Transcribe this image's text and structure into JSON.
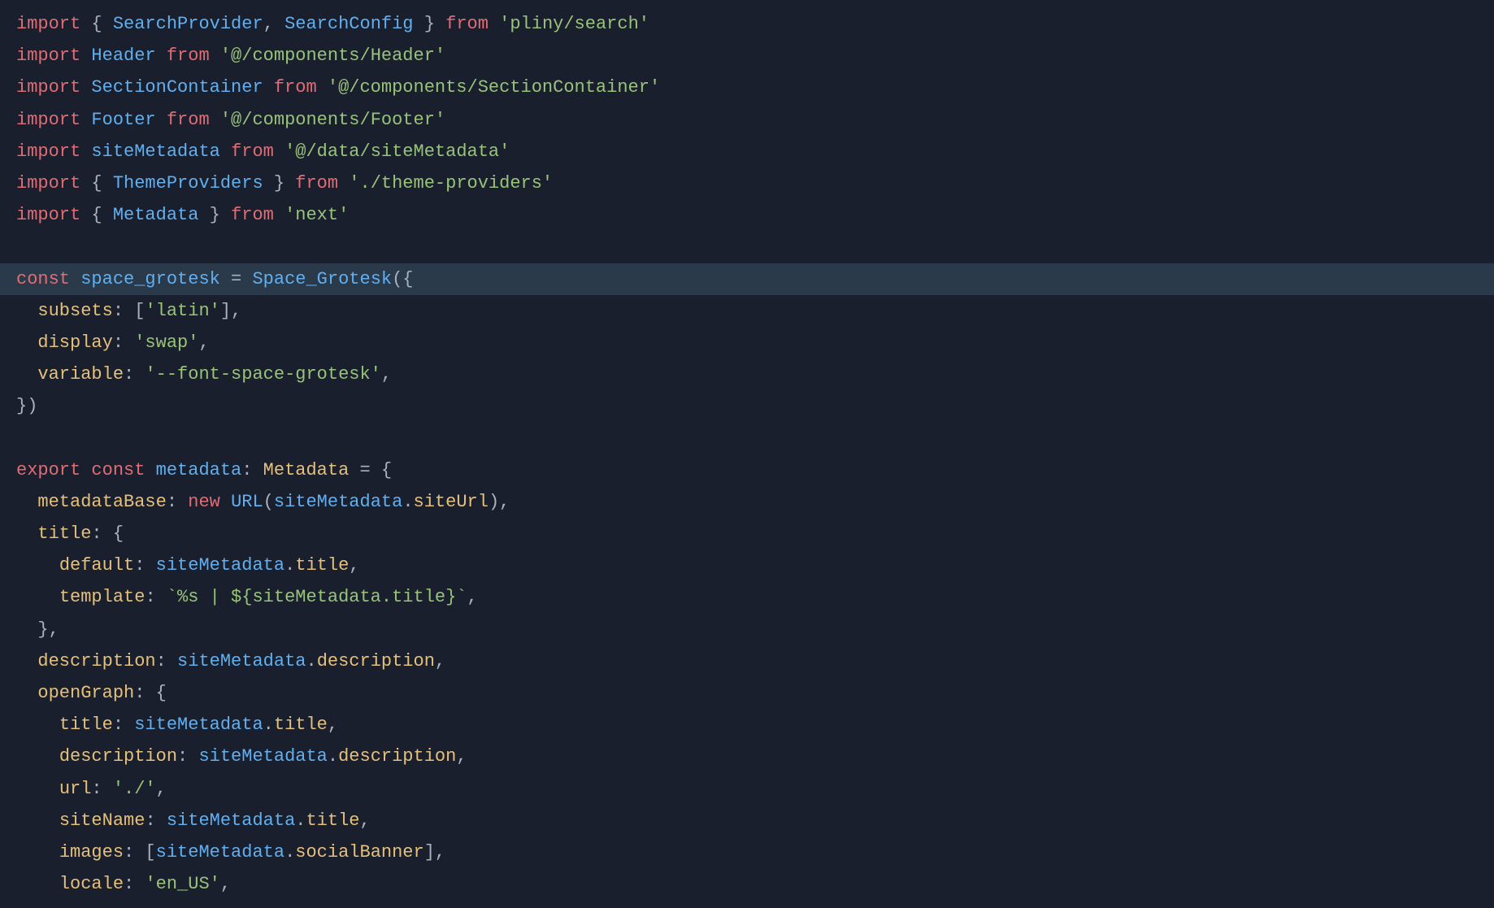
{
  "editor": {
    "background": "#1a1f2e",
    "lines": [
      {
        "id": 1,
        "highlighted": false,
        "tokens": [
          {
            "type": "kw-import",
            "text": "import"
          },
          {
            "type": "default-text",
            "text": " { "
          },
          {
            "type": "fn-name",
            "text": "SearchProvider"
          },
          {
            "type": "default-text",
            "text": ", "
          },
          {
            "type": "fn-name",
            "text": "SearchConfig"
          },
          {
            "type": "default-text",
            "text": " } "
          },
          {
            "type": "kw-from",
            "text": "from"
          },
          {
            "type": "default-text",
            "text": " "
          },
          {
            "type": "string",
            "text": "'pliny/search'"
          }
        ]
      },
      {
        "id": 2,
        "highlighted": false,
        "tokens": [
          {
            "type": "kw-import",
            "text": "import"
          },
          {
            "type": "default-text",
            "text": " "
          },
          {
            "type": "fn-name",
            "text": "Header"
          },
          {
            "type": "default-text",
            "text": " "
          },
          {
            "type": "kw-from",
            "text": "from"
          },
          {
            "type": "default-text",
            "text": " "
          },
          {
            "type": "string",
            "text": "'@/components/Header'"
          }
        ]
      },
      {
        "id": 3,
        "highlighted": false,
        "tokens": [
          {
            "type": "kw-import",
            "text": "import"
          },
          {
            "type": "default-text",
            "text": " "
          },
          {
            "type": "fn-name",
            "text": "SectionContainer"
          },
          {
            "type": "default-text",
            "text": " "
          },
          {
            "type": "kw-from",
            "text": "from"
          },
          {
            "type": "default-text",
            "text": " "
          },
          {
            "type": "string",
            "text": "'@/components/SectionContainer'"
          }
        ]
      },
      {
        "id": 4,
        "highlighted": false,
        "tokens": [
          {
            "type": "kw-import",
            "text": "import"
          },
          {
            "type": "default-text",
            "text": " "
          },
          {
            "type": "fn-name",
            "text": "Footer"
          },
          {
            "type": "default-text",
            "text": " "
          },
          {
            "type": "kw-from",
            "text": "from"
          },
          {
            "type": "default-text",
            "text": " "
          },
          {
            "type": "string",
            "text": "'@/components/Footer'"
          }
        ]
      },
      {
        "id": 5,
        "highlighted": false,
        "tokens": [
          {
            "type": "kw-import",
            "text": "import"
          },
          {
            "type": "default-text",
            "text": " "
          },
          {
            "type": "fn-name",
            "text": "siteMetadata"
          },
          {
            "type": "default-text",
            "text": " "
          },
          {
            "type": "kw-from",
            "text": "from"
          },
          {
            "type": "default-text",
            "text": " "
          },
          {
            "type": "string",
            "text": "'@/data/siteMetadata'"
          }
        ]
      },
      {
        "id": 6,
        "highlighted": false,
        "tokens": [
          {
            "type": "kw-import",
            "text": "import"
          },
          {
            "type": "default-text",
            "text": " { "
          },
          {
            "type": "fn-name",
            "text": "ThemeProviders"
          },
          {
            "type": "default-text",
            "text": " } "
          },
          {
            "type": "kw-from",
            "text": "from"
          },
          {
            "type": "default-text",
            "text": " "
          },
          {
            "type": "string",
            "text": "'./theme-providers'"
          }
        ]
      },
      {
        "id": 7,
        "highlighted": false,
        "tokens": [
          {
            "type": "kw-import",
            "text": "import"
          },
          {
            "type": "default-text",
            "text": " { "
          },
          {
            "type": "fn-name",
            "text": "Metadata"
          },
          {
            "type": "default-text",
            "text": " } "
          },
          {
            "type": "kw-from",
            "text": "from"
          },
          {
            "type": "default-text",
            "text": " "
          },
          {
            "type": "string",
            "text": "'next'"
          }
        ]
      },
      {
        "id": 8,
        "highlighted": false,
        "empty": true,
        "tokens": []
      },
      {
        "id": 9,
        "highlighted": true,
        "tokens": [
          {
            "type": "kw-const",
            "text": "const"
          },
          {
            "type": "default-text",
            "text": " "
          },
          {
            "type": "val-blue",
            "text": "space_grotesk"
          },
          {
            "type": "default-text",
            "text": " = "
          },
          {
            "type": "fn-name",
            "text": "Space_Grotesk"
          },
          {
            "type": "default-text",
            "text": "({"
          }
        ]
      },
      {
        "id": 10,
        "highlighted": false,
        "tokens": [
          {
            "type": "default-text",
            "text": "  "
          },
          {
            "type": "prop",
            "text": "subsets"
          },
          {
            "type": "default-text",
            "text": ": ["
          },
          {
            "type": "string",
            "text": "'latin'"
          },
          {
            "type": "default-text",
            "text": "],"
          }
        ]
      },
      {
        "id": 11,
        "highlighted": false,
        "tokens": [
          {
            "type": "default-text",
            "text": "  "
          },
          {
            "type": "prop",
            "text": "display"
          },
          {
            "type": "default-text",
            "text": ": "
          },
          {
            "type": "string",
            "text": "'swap'"
          },
          {
            "type": "default-text",
            "text": ","
          }
        ]
      },
      {
        "id": 12,
        "highlighted": false,
        "tokens": [
          {
            "type": "default-text",
            "text": "  "
          },
          {
            "type": "prop",
            "text": "variable"
          },
          {
            "type": "default-text",
            "text": ": "
          },
          {
            "type": "string",
            "text": "'--font-space-grotesk'"
          },
          {
            "type": "default-text",
            "text": ","
          }
        ]
      },
      {
        "id": 13,
        "highlighted": false,
        "tokens": [
          {
            "type": "default-text",
            "text": "})"
          }
        ]
      },
      {
        "id": 14,
        "highlighted": false,
        "empty": true,
        "tokens": []
      },
      {
        "id": 15,
        "highlighted": false,
        "tokens": [
          {
            "type": "kw-export",
            "text": "export"
          },
          {
            "type": "default-text",
            "text": " "
          },
          {
            "type": "kw-const",
            "text": "const"
          },
          {
            "type": "default-text",
            "text": " "
          },
          {
            "type": "val-blue",
            "text": "metadata"
          },
          {
            "type": "default-text",
            "text": ": "
          },
          {
            "type": "type-name",
            "text": "Metadata"
          },
          {
            "type": "default-text",
            "text": " = {"
          }
        ]
      },
      {
        "id": 16,
        "highlighted": false,
        "tokens": [
          {
            "type": "default-text",
            "text": "  "
          },
          {
            "type": "prop",
            "text": "metadataBase"
          },
          {
            "type": "default-text",
            "text": ": "
          },
          {
            "type": "kw-new",
            "text": "new"
          },
          {
            "type": "default-text",
            "text": " "
          },
          {
            "type": "url-fn",
            "text": "URL"
          },
          {
            "type": "default-text",
            "text": "("
          },
          {
            "type": "val-blue",
            "text": "siteMetadata"
          },
          {
            "type": "default-text",
            "text": "."
          },
          {
            "type": "prop",
            "text": "siteUrl"
          },
          {
            "type": "default-text",
            "text": "),"
          }
        ]
      },
      {
        "id": 17,
        "highlighted": false,
        "tokens": [
          {
            "type": "default-text",
            "text": "  "
          },
          {
            "type": "prop",
            "text": "title"
          },
          {
            "type": "default-text",
            "text": ": {"
          }
        ]
      },
      {
        "id": 18,
        "highlighted": false,
        "tokens": [
          {
            "type": "default-text",
            "text": "    "
          },
          {
            "type": "prop",
            "text": "default"
          },
          {
            "type": "default-text",
            "text": ": "
          },
          {
            "type": "val-blue",
            "text": "siteMetadata"
          },
          {
            "type": "default-text",
            "text": "."
          },
          {
            "type": "prop",
            "text": "title"
          },
          {
            "type": "default-text",
            "text": ","
          }
        ]
      },
      {
        "id": 19,
        "highlighted": false,
        "tokens": [
          {
            "type": "default-text",
            "text": "    "
          },
          {
            "type": "prop",
            "text": "template"
          },
          {
            "type": "default-text",
            "text": ": "
          },
          {
            "type": "string",
            "text": "`%s | ${siteMetadata.title}`"
          },
          {
            "type": "default-text",
            "text": ","
          }
        ]
      },
      {
        "id": 20,
        "highlighted": false,
        "tokens": [
          {
            "type": "default-text",
            "text": "  },"
          }
        ]
      },
      {
        "id": 21,
        "highlighted": false,
        "tokens": [
          {
            "type": "default-text",
            "text": "  "
          },
          {
            "type": "prop",
            "text": "description"
          },
          {
            "type": "default-text",
            "text": ": "
          },
          {
            "type": "val-blue",
            "text": "siteMetadata"
          },
          {
            "type": "default-text",
            "text": "."
          },
          {
            "type": "prop",
            "text": "description"
          },
          {
            "type": "default-text",
            "text": ","
          }
        ]
      },
      {
        "id": 22,
        "highlighted": false,
        "tokens": [
          {
            "type": "default-text",
            "text": "  "
          },
          {
            "type": "prop",
            "text": "openGraph"
          },
          {
            "type": "default-text",
            "text": ": {"
          }
        ]
      },
      {
        "id": 23,
        "highlighted": false,
        "tokens": [
          {
            "type": "default-text",
            "text": "    "
          },
          {
            "type": "prop",
            "text": "title"
          },
          {
            "type": "default-text",
            "text": ": "
          },
          {
            "type": "val-blue",
            "text": "siteMetadata"
          },
          {
            "type": "default-text",
            "text": "."
          },
          {
            "type": "prop",
            "text": "title"
          },
          {
            "type": "default-text",
            "text": ","
          }
        ]
      },
      {
        "id": 24,
        "highlighted": false,
        "tokens": [
          {
            "type": "default-text",
            "text": "    "
          },
          {
            "type": "prop",
            "text": "description"
          },
          {
            "type": "default-text",
            "text": ": "
          },
          {
            "type": "val-blue",
            "text": "siteMetadata"
          },
          {
            "type": "default-text",
            "text": "."
          },
          {
            "type": "prop",
            "text": "description"
          },
          {
            "type": "default-text",
            "text": ","
          }
        ]
      },
      {
        "id": 25,
        "highlighted": false,
        "tokens": [
          {
            "type": "default-text",
            "text": "    "
          },
          {
            "type": "prop",
            "text": "url"
          },
          {
            "type": "default-text",
            "text": ": "
          },
          {
            "type": "string",
            "text": "'./'"
          },
          {
            "type": "default-text",
            "text": ","
          }
        ]
      },
      {
        "id": 26,
        "highlighted": false,
        "tokens": [
          {
            "type": "default-text",
            "text": "    "
          },
          {
            "type": "prop",
            "text": "siteName"
          },
          {
            "type": "default-text",
            "text": ": "
          },
          {
            "type": "val-blue",
            "text": "siteMetadata"
          },
          {
            "type": "default-text",
            "text": "."
          },
          {
            "type": "prop",
            "text": "title"
          },
          {
            "type": "default-text",
            "text": ","
          }
        ]
      },
      {
        "id": 27,
        "highlighted": false,
        "tokens": [
          {
            "type": "default-text",
            "text": "    "
          },
          {
            "type": "prop",
            "text": "images"
          },
          {
            "type": "default-text",
            "text": ": ["
          },
          {
            "type": "val-blue",
            "text": "siteMetadata"
          },
          {
            "type": "default-text",
            "text": "."
          },
          {
            "type": "prop",
            "text": "socialBanner"
          },
          {
            "type": "default-text",
            "text": "],"
          }
        ]
      },
      {
        "id": 28,
        "highlighted": false,
        "tokens": [
          {
            "type": "default-text",
            "text": "    "
          },
          {
            "type": "prop",
            "text": "locale"
          },
          {
            "type": "default-text",
            "text": ": "
          },
          {
            "type": "string",
            "text": "'en_US'"
          },
          {
            "type": "default-text",
            "text": ","
          }
        ]
      }
    ]
  }
}
